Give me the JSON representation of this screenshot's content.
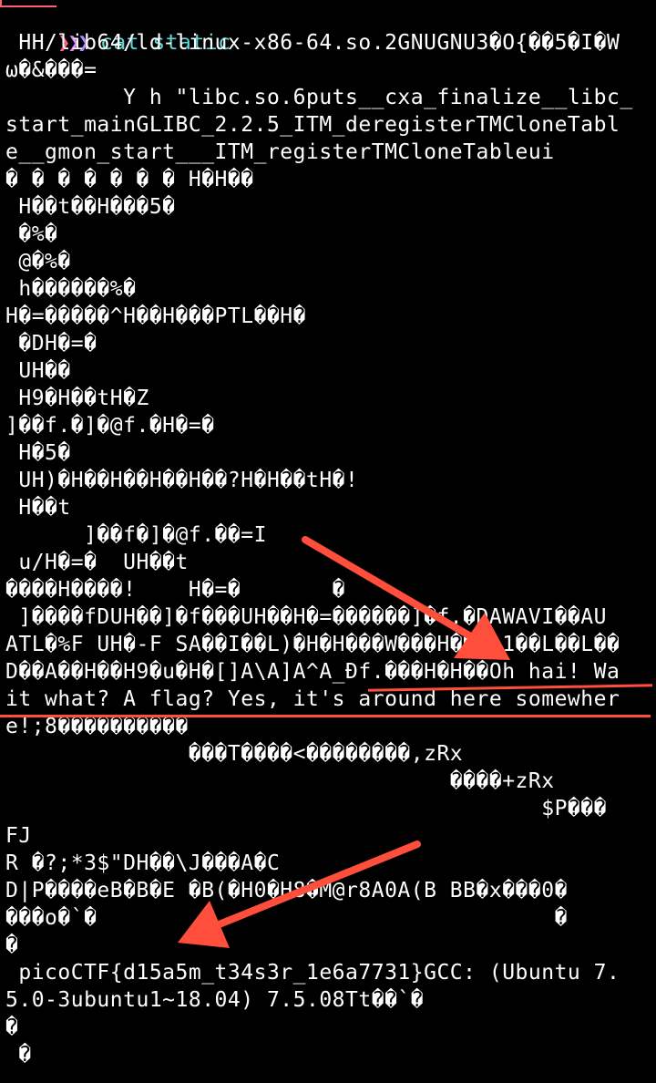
{
  "prompt": {
    "chevrons": "❯❯❯",
    "command": "cat static"
  },
  "output_lines": [
    " HH/lib64/ld-linux-x86-64.so.2GNUGNU3�O{��5�I�W",
    "ω�&���=",
    "         Y h \"libc.so.6puts__cxa_finalize__libc_",
    "start_mainGLIBC_2.2.5_ITM_deregisterTMCloneTabl",
    "e__gmon_start___ITM_registerTMCloneTableui",
    "� � � � � � � H�H��",
    " H��t��H���5�",
    " �%�",
    " @�%�",
    " h������%�",
    "H�=�����^H��H���PTL��H�",
    " �DH�=�",
    " UH��",
    " H9�H��tH�Z",
    "]��f.�]�@f.�H�=�",
    " H�5�",
    " UH)�H��H��H��H��?H�H��tH�!",
    " H��t",
    "      ]��f�]�@f.��=I",
    " u/H�=�  UH��t",
    "����H����!    H�=�       �",
    " ]����fDUH��]�f���UH��H�=������]�f.�DAWAVI��AU",
    "ATL�%F UH�-F SA��I��L)�H�H���W���H��t 1��L��L��",
    "D��A��H��H9�u�H�[]A\\A]A^A_Ðf.���H�H��Oh hai! Wa",
    "it what? A flag? Yes, it's around here somewher",
    "e!;8����������",
    "              ���T����<��������,zRx",
    "                                  ����+zRx",
    "                                         $P���",
    "FJ",
    "R �?;*3$\"DH��\\J���A�C",
    "D|P����eB�B�E �B(�H0�H8�M@r8A0A(B BB�x���0�",
    "���o�`�                                   �",
    "�",
    " picoCTF{d15a5m_t34s3r_1e6a7731}GCC: (Ubuntu 7.",
    "5.0-3ubuntu1~18.04) 7.5.08Tt��`�",
    "�",
    " �"
  ],
  "colors": {
    "background": "#000000",
    "text": "#ffffff",
    "command": "#5fd7d7",
    "annotation": "#ff4e3c"
  }
}
